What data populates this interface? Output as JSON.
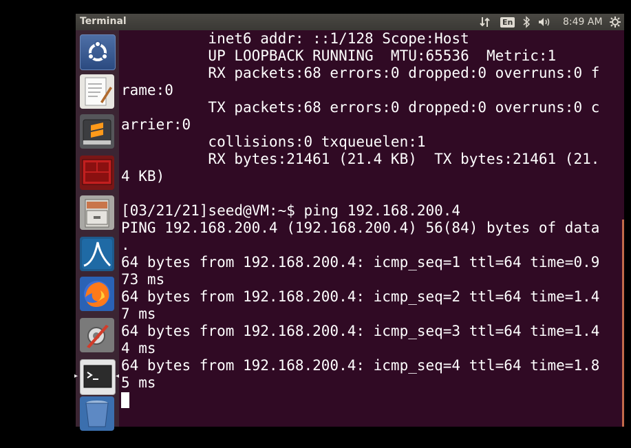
{
  "topbar": {
    "title": "Terminal",
    "lang": "En",
    "clock": "8:49 AM",
    "icons": [
      "network-updown-icon",
      "keyboard-language-icon",
      "bluetooth-icon",
      "volume-icon",
      "gear-icon"
    ]
  },
  "launcher": {
    "items": [
      {
        "name": "ubuntu-dash",
        "icon": "ubuntu-logo-icon"
      },
      {
        "name": "text-editor",
        "icon": "text-editor-icon"
      },
      {
        "name": "sublime-text",
        "icon": "sublime-text-icon"
      },
      {
        "name": "terminator",
        "icon": "terminator-icon"
      },
      {
        "name": "files",
        "icon": "file-cabinet-icon"
      },
      {
        "name": "wireshark",
        "icon": "wireshark-icon"
      },
      {
        "name": "firefox",
        "icon": "firefox-icon"
      },
      {
        "name": "system-settings",
        "icon": "settings-tools-icon"
      },
      {
        "name": "terminal",
        "icon": "terminal-icon",
        "active": true
      },
      {
        "name": "trash",
        "icon": "trash-icon"
      }
    ]
  },
  "terminal": {
    "lines": [
      "          inet6 addr: ::1/128 Scope:Host",
      "          UP LOOPBACK RUNNING  MTU:65536  Metric:1",
      "          RX packets:68 errors:0 dropped:0 overruns:0 f",
      "rame:0",
      "          TX packets:68 errors:0 dropped:0 overruns:0 c",
      "arrier:0",
      "          collisions:0 txqueuelen:1",
      "          RX bytes:21461 (21.4 KB)  TX bytes:21461 (21.",
      "4 KB)",
      "",
      "[03/21/21]seed@VM:~$ ping 192.168.200.4",
      "PING 192.168.200.4 (192.168.200.4) 56(84) bytes of data",
      ".",
      "64 bytes from 192.168.200.4: icmp_seq=1 ttl=64 time=0.9",
      "73 ms",
      "64 bytes from 192.168.200.4: icmp_seq=2 ttl=64 time=1.4",
      "7 ms",
      "64 bytes from 192.168.200.4: icmp_seq=3 ttl=64 time=1.4",
      "4 ms",
      "64 bytes from 192.168.200.4: icmp_seq=4 ttl=64 time=1.8",
      "5 ms"
    ]
  },
  "colors": {
    "terminal_bg": "#300a24",
    "launcher_bg": "#3b2533",
    "panel_bg": "#3a3935",
    "scrollbar": "#c46a4a"
  }
}
